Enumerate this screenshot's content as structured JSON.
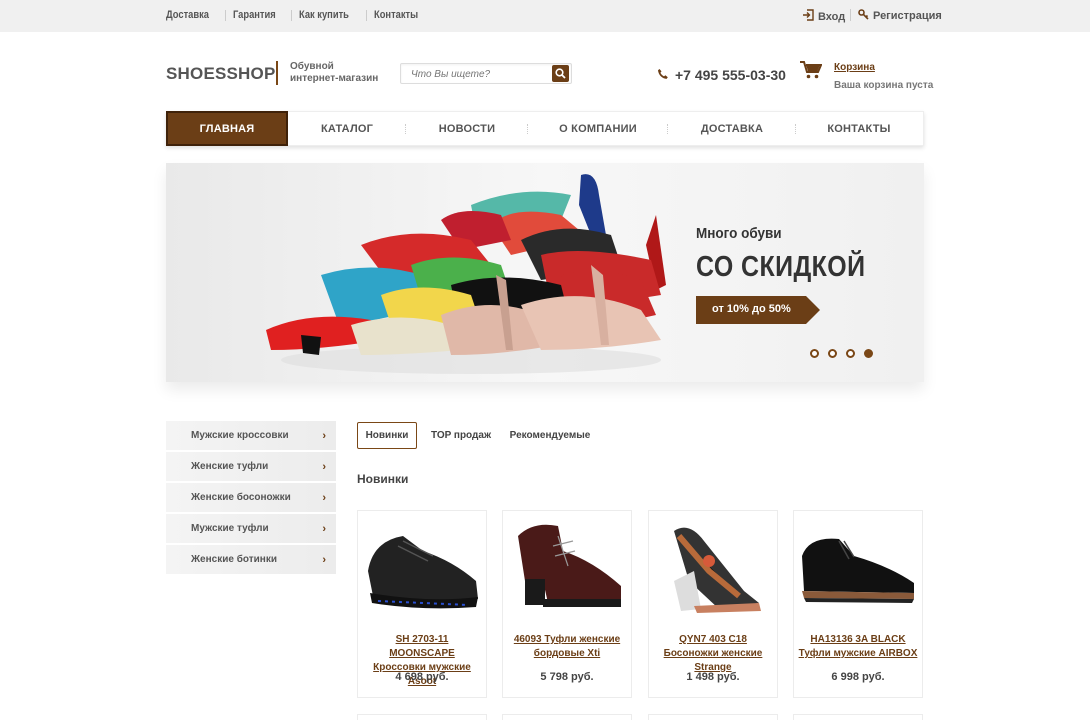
{
  "topbar": {
    "links": [
      "Доставка",
      "Гарантия",
      "Как купить",
      "Контакты"
    ],
    "login": "Вход",
    "register": "Регистрация"
  },
  "header": {
    "logo": "SHOESSHOP",
    "tagline": "Обувной интернет-магазин",
    "search_placeholder": "Что Вы ищете?",
    "phone": "+7 495 555-03-30",
    "cart_label": "Корзина",
    "cart_status": "Ваша корзина пуста"
  },
  "nav": {
    "items": [
      "ГЛАВНАЯ",
      "КАТАЛОГ",
      "НОВОСТИ",
      "О КОМПАНИИ",
      "ДОСТАВКА",
      "КОНТАКТЫ"
    ],
    "active_index": 0
  },
  "hero": {
    "subtitle": "Много обуви",
    "title": "СО СКИДКОЙ",
    "badge": "от 10% до 50%",
    "slides": 4,
    "active_slide": 4
  },
  "sidebar": {
    "items": [
      "Мужские кроссовки",
      "Женские туфли",
      "Женские босоножки",
      "Мужские туфли",
      "Женские ботинки"
    ]
  },
  "tabs": {
    "items": [
      "Новинки",
      "TOP продаж",
      "Рекомендуемые"
    ],
    "active_index": 0
  },
  "section_title": "Новинки",
  "products": [
    {
      "name": "SH 2703-11 MOONSCAPE Кроссовки мужские Asoot",
      "price": "4 698 руб."
    },
    {
      "name": "46093 Туфли женские бордовые Xti",
      "price": "5 798 руб."
    },
    {
      "name": "QYN7 403 C18 Босоножки женские Strange",
      "price": "1 498 руб."
    },
    {
      "name": "HA13136 3A BLACK Туфли мужские AIRBOX",
      "price": "6 998 руб."
    }
  ],
  "colors": {
    "accent": "#6b3e16",
    "topbar_bg": "#f0f0f0"
  }
}
